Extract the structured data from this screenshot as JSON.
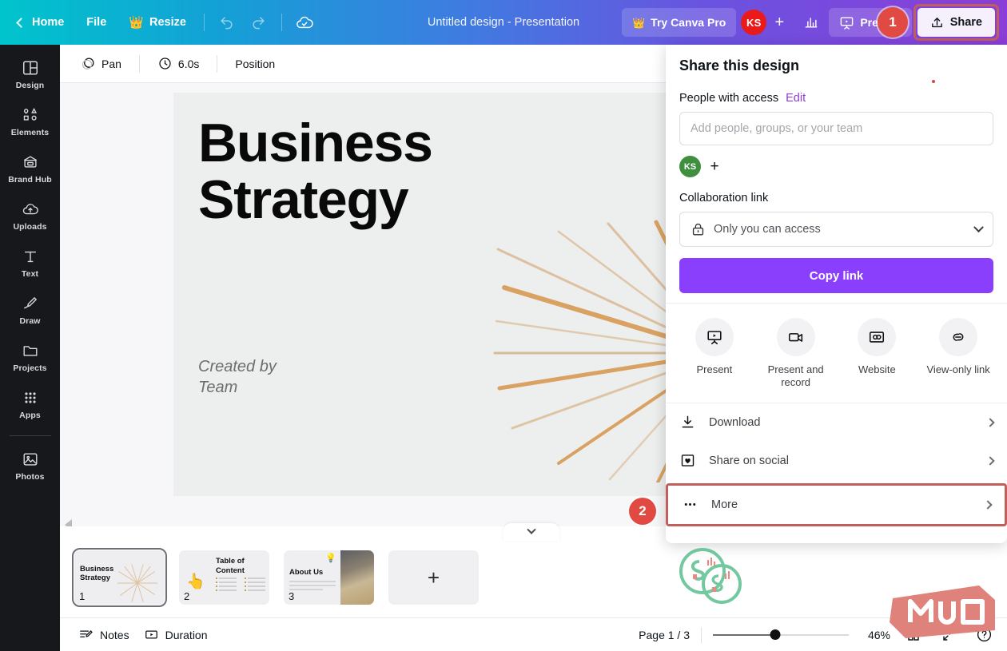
{
  "topbar": {
    "back_label": "Home",
    "file_label": "File",
    "resize_label": "Resize",
    "doc_title": "Untitled design - Presentation",
    "try_pro_label": "Try Canva Pro",
    "avatar_initials": "KS",
    "add_member_label": "+",
    "present_label": "Present",
    "share_label": "Share",
    "gradient_start": "#00c4cc",
    "gradient_end": "#8b3dd8"
  },
  "markers": {
    "one": "1",
    "two": "2",
    "color": "#e04a42"
  },
  "rail": {
    "items": [
      {
        "label": "Design",
        "icon": "design-icon"
      },
      {
        "label": "Elements",
        "icon": "elements-icon"
      },
      {
        "label": "Brand Hub",
        "icon": "brand-hub-icon"
      },
      {
        "label": "Uploads",
        "icon": "uploads-icon"
      },
      {
        "label": "Text",
        "icon": "text-icon"
      },
      {
        "label": "Draw",
        "icon": "draw-icon"
      },
      {
        "label": "Projects",
        "icon": "projects-icon"
      },
      {
        "label": "Apps",
        "icon": "apps-icon"
      },
      {
        "label": "Photos",
        "icon": "photos-icon"
      }
    ]
  },
  "subbar": {
    "pan_label": "Pan",
    "duration_label": "6.0s",
    "position_label": "Position"
  },
  "canvas": {
    "slide_title_line1": "Business",
    "slide_title_line2": "Strategy",
    "slide_sub_line1": "Created by",
    "slide_sub_line2": "Team",
    "sunburst_color": "#d7ab74"
  },
  "pages": {
    "thumbs": [
      {
        "num": "1",
        "title_line1": "Business",
        "title_line2": "Strategy",
        "selected": true
      },
      {
        "num": "2",
        "title_line1": "Table of",
        "title_line2": "Content",
        "selected": false
      },
      {
        "num": "3",
        "title_line1": "About Us",
        "title_line2": "",
        "selected": false
      }
    ],
    "add_label": "+"
  },
  "statusbar": {
    "notes_label": "Notes",
    "duration_label": "Duration",
    "page_counter": "Page 1 / 3",
    "zoom_value": "46%",
    "grid_view_icon": "grid-view-icon",
    "fullscreen_icon": "fullscreen-icon",
    "help_icon": "help-icon"
  },
  "share_panel": {
    "title": "Share this design",
    "people_label": "People with access",
    "edit_label": "Edit",
    "input_placeholder": "Add people, groups, or your team",
    "input_value": "",
    "person_initials": "KS",
    "add_person_label": "+",
    "collab_label": "Collaboration link",
    "access_value": "Only you can access",
    "copy_label": "Copy link",
    "quick_actions": [
      {
        "label": "Present",
        "icon": "present-icon"
      },
      {
        "label": "Present and record",
        "icon": "present-record-icon"
      },
      {
        "label": "Website",
        "icon": "website-icon"
      },
      {
        "label": "View-only link",
        "icon": "view-only-link-icon"
      }
    ],
    "list_items": [
      {
        "label": "Download",
        "icon": "download-icon",
        "highlighted": false
      },
      {
        "label": "Share on social",
        "icon": "share-social-icon",
        "highlighted": false
      },
      {
        "label": "More",
        "icon": "more-icon",
        "highlighted": true
      }
    ],
    "accent_color": "#8a3ffc",
    "highlight_color": "#c0605c"
  }
}
